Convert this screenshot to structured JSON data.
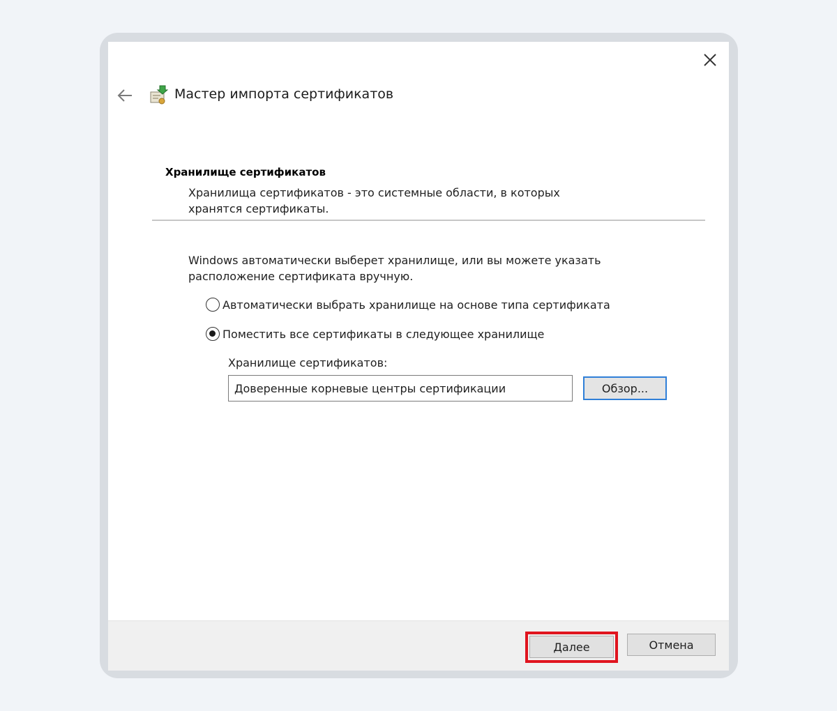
{
  "window": {
    "close_icon": "close-icon",
    "back_icon": "back-arrow-icon",
    "wizard_icon": "certificate-import-icon",
    "title": "Мастер импорта сертификатов"
  },
  "header": {
    "heading": "Хранилище сертификатов",
    "description_line1": "Хранилища сертификатов - это системные области, в которых",
    "description_line2": "хранятся сертификаты."
  },
  "body": {
    "intro_line1": "Windows автоматически выберет хранилище, или вы можете указать",
    "intro_line2": "расположение сертификата вручную.",
    "options": [
      {
        "label": "Автоматически выбрать хранилище на основе типа сертификата",
        "selected": false
      },
      {
        "label": "Поместить все сертификаты в следующее хранилище",
        "selected": true
      }
    ],
    "store_label": "Хранилище сертификатов:",
    "store_value": "Доверенные корневые центры сертификации",
    "browse_label": "Обзор..."
  },
  "footer": {
    "next_label": "Далее",
    "cancel_label": "Отмена",
    "highlight_color": "#e0141e"
  }
}
